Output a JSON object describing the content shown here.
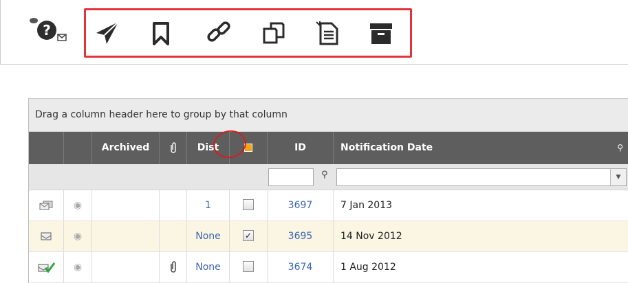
{
  "toolbar": {
    "buttons": [
      {
        "name": "send-icon"
      },
      {
        "name": "bookmark-icon"
      },
      {
        "name": "link-icon"
      },
      {
        "name": "copy-icon"
      },
      {
        "name": "new-document-icon"
      },
      {
        "name": "archive-icon"
      }
    ],
    "highlight_color": "#e4323a"
  },
  "grid": {
    "group_panel_text": "Drag a column header here to group by that column",
    "columns": {
      "archived": "Archived",
      "dist": "Dist",
      "id": "ID",
      "notification_date": "Notification Date"
    },
    "rows": [
      {
        "type_icon": "multi-envelope-icon",
        "dist": "1",
        "checked": false,
        "id": "3697",
        "date": "7 Jan 2013",
        "attachment": false
      },
      {
        "type_icon": "envelope-icon",
        "dist": "None",
        "checked": true,
        "id": "3695",
        "date": "14 Nov 2012",
        "attachment": false
      },
      {
        "type_icon": "envelope-check-icon",
        "dist": "None",
        "checked": false,
        "id": "3674",
        "date": "1 Aug 2012",
        "attachment": true
      }
    ],
    "header_bg": "#5e5e5e",
    "link_color": "#3a63b5"
  }
}
